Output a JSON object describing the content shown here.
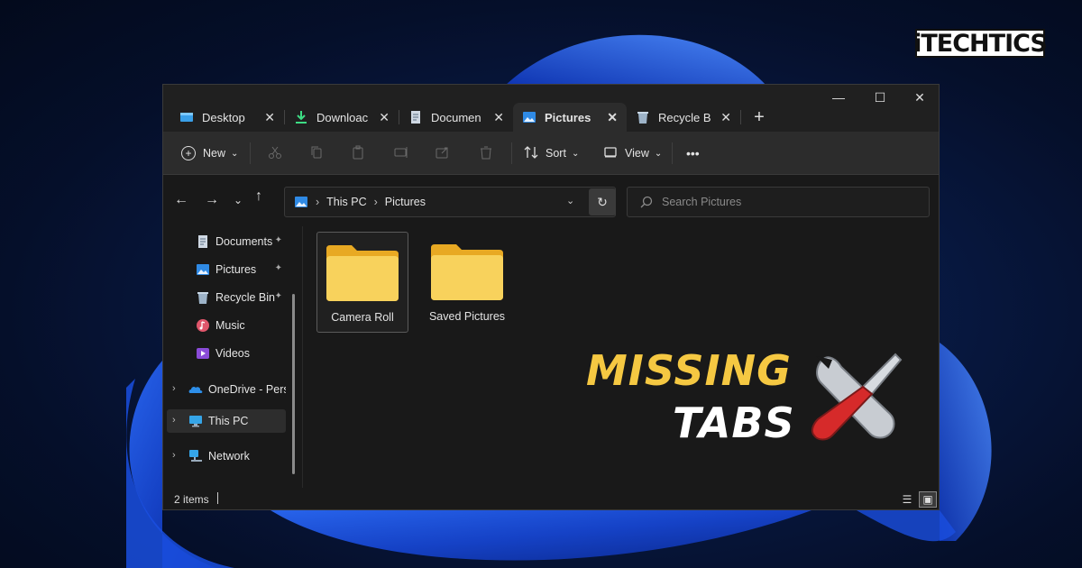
{
  "brand": {
    "logo_text": "iTECHTICS"
  },
  "overlay": {
    "line1": "MISSING",
    "line2": "TABS"
  },
  "colors": {
    "accent_yellow": "#f5c842",
    "folder": "#f6c94f",
    "window_bg": "#191919",
    "toolbar_bg": "#2c2c2c"
  },
  "window": {
    "controls": {
      "minimize": "—",
      "maximize": "☐",
      "close": "✕"
    },
    "tabs": [
      {
        "label": "Desktop",
        "icon": "desktop-icon",
        "close": "✕"
      },
      {
        "label": "Downloac",
        "icon": "download-icon",
        "close": "✕"
      },
      {
        "label": "Documen",
        "icon": "document-icon",
        "close": "✕"
      },
      {
        "label": "Pictures",
        "icon": "pictures-icon",
        "close": "✕",
        "active": true
      },
      {
        "label": "Recycle Bi",
        "icon": "recycle-bin-icon",
        "close": "✕"
      }
    ],
    "new_tab": "+"
  },
  "toolbar": {
    "new_label": "New",
    "sort_label": "Sort",
    "view_label": "View",
    "more": "•••",
    "chevron": "⌄"
  },
  "navigation": {
    "back": "←",
    "forward": "→",
    "recent": "⌄",
    "up": "↑",
    "breadcrumb": [
      "This PC",
      "Pictures"
    ],
    "sep": "›",
    "dropdown": "⌄",
    "refresh": "↻",
    "search_placeholder": "Search Pictures"
  },
  "sidebar": {
    "items": [
      {
        "label": "Documents",
        "icon": "document-icon",
        "pinned": true
      },
      {
        "label": "Pictures",
        "icon": "pictures-icon",
        "pinned": true
      },
      {
        "label": "Recycle Bin",
        "icon": "recycle-bin-icon",
        "pinned": true
      },
      {
        "label": "Music",
        "icon": "music-icon"
      },
      {
        "label": "Videos",
        "icon": "videos-icon"
      },
      {
        "label": "OneDrive - Perso",
        "icon": "onedrive-icon",
        "expandable": true
      },
      {
        "label": "This PC",
        "icon": "this-pc-icon",
        "expandable": true,
        "selected": true
      },
      {
        "label": "Network",
        "icon": "network-icon",
        "expandable": true
      }
    ],
    "pin": "📌",
    "chevron": "›"
  },
  "content": {
    "folders": [
      {
        "name": "Camera Roll",
        "selected": true
      },
      {
        "name": "Saved Pictures"
      }
    ]
  },
  "status": {
    "items_count": "2 items"
  }
}
